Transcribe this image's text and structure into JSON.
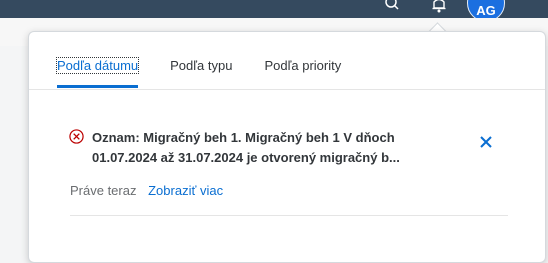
{
  "shell": {
    "avatar_initials": "AG"
  },
  "tabs": [
    {
      "label": "Podľa dátumu",
      "active": true
    },
    {
      "label": "Podľa typu",
      "active": false
    },
    {
      "label": "Podľa priority",
      "active": false
    }
  ],
  "notification": {
    "line1": "Oznam: Migračný beh 1. Migračný beh 1 V dňoch",
    "line2": "01.07.2024 až 31.07.2024 je otvorený migračný b...",
    "time": "Práve teraz",
    "show_more": "Zobraziť viac",
    "status_color": "#bb0000"
  },
  "colors": {
    "shell": "#354a5f",
    "accent": "#0a6ed1"
  }
}
